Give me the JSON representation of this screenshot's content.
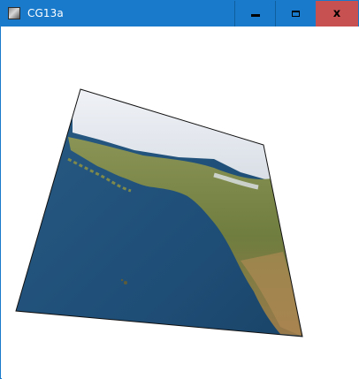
{
  "window": {
    "title": "CG13a",
    "controls": {
      "minimize_icon": "minimize-icon",
      "maximize_icon": "maximize-icon",
      "close_icon": "close-icon",
      "close_glyph": "x"
    }
  },
  "colors": {
    "titlebar": "#1979ca",
    "close_button": "#c75050",
    "ocean": "#1f4f78",
    "land": "#7a8a4a",
    "snow": "#e6eaf0"
  }
}
